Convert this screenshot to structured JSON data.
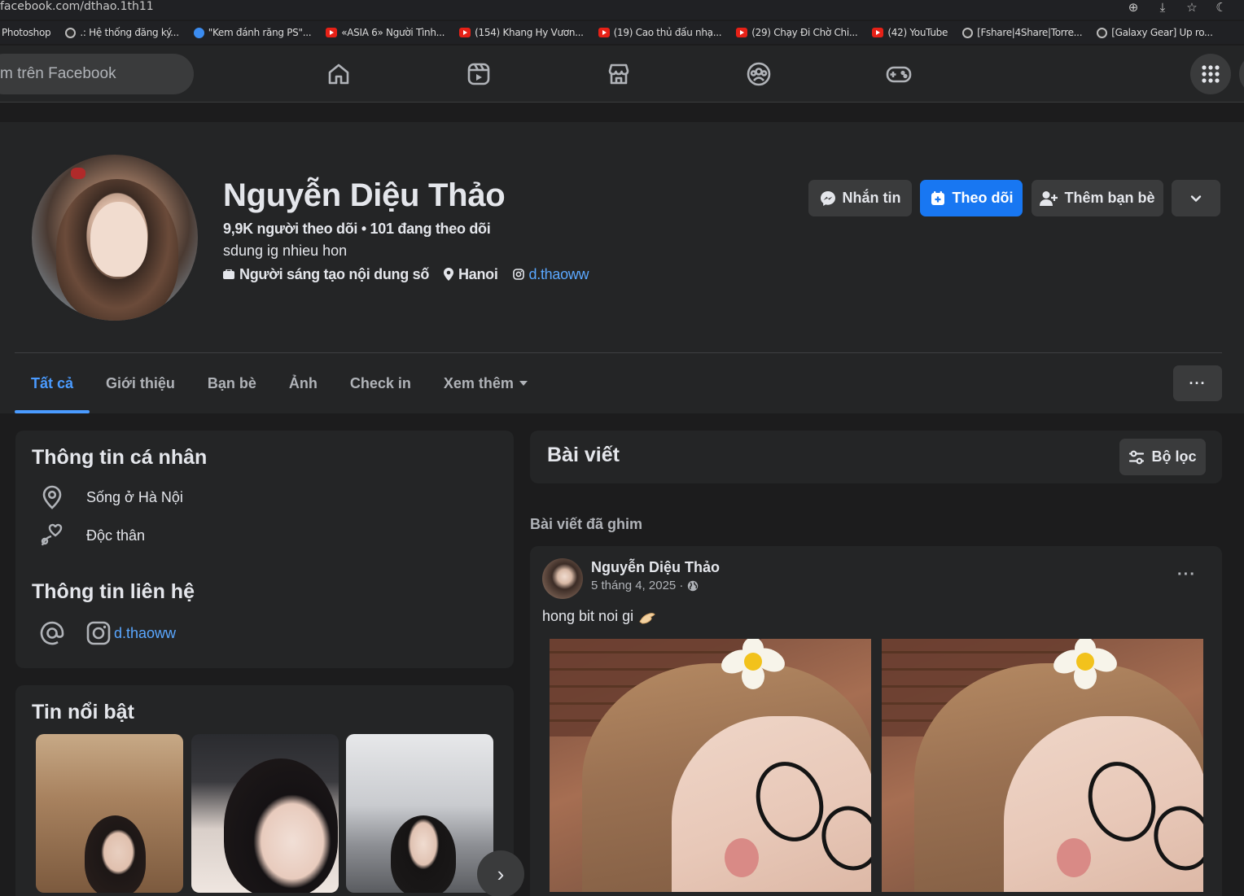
{
  "browser": {
    "url": "facebook.com/dthao.1th11",
    "bookmarks": [
      {
        "label": "Photoshop",
        "icon": "none"
      },
      {
        "label": ".: Hệ thống đăng ký...",
        "icon": "globe"
      },
      {
        "label": "\"Kem đánh răng PS\"...",
        "icon": "blue"
      },
      {
        "label": "«ASIA 6» Người Tình...",
        "icon": "youtube"
      },
      {
        "label": "(154) Khang Hy Vươn...",
        "icon": "youtube"
      },
      {
        "label": "(19) Cao thủ đấu nhạ...",
        "icon": "youtube"
      },
      {
        "label": "(29) Chạy Đi Chờ Chi...",
        "icon": "youtube"
      },
      {
        "label": "(42) YouTube",
        "icon": "youtube"
      },
      {
        "label": "[Fshare|4Share|Torre...",
        "icon": "globe"
      },
      {
        "label": "[Galaxy Gear] Up ro...",
        "icon": "globe"
      }
    ]
  },
  "nav": {
    "search_placeholder": "m trên Facebook",
    "icons": [
      "home-icon",
      "reels-icon",
      "marketplace-icon",
      "groups-icon",
      "gaming-icon"
    ],
    "menu_icon": "grid-menu-icon"
  },
  "profile": {
    "name": "Nguyễn Diệu Thảo",
    "stats": "9,9K người theo dõi • 101 đang theo dõi",
    "bio": "sdung ig nhieu hon",
    "category": "Người sáng tạo nội dung số",
    "location": "Hanoi",
    "instagram": "d.thaoww",
    "buttons": {
      "message": "Nhắn tin",
      "follow": "Theo dõi",
      "add_friend": "Thêm bạn bè"
    }
  },
  "tabs": {
    "items": [
      "Tất cả",
      "Giới thiệu",
      "Bạn bè",
      "Ảnh",
      "Check in",
      "Xem thêm"
    ],
    "active": "Tất cả",
    "more_label": "···"
  },
  "intro": {
    "title": "Thông tin cá nhân",
    "lives_in": "Sống ở Hà Nội",
    "relationship": "Độc thân",
    "contact_title": "Thông tin liên hệ",
    "instagram": "d.thaoww"
  },
  "featured": {
    "title": "Tin nổi bật",
    "next_label": "›"
  },
  "posts": {
    "title": "Bài viết",
    "filter_label": "Bộ lọc",
    "pinned_label": "Bài viết đã ghim",
    "pinned_post": {
      "author": "Nguyễn Diệu Thảo",
      "date": "5 tháng 4, 2025 ·",
      "text": "hong bit noi gi",
      "menu_label": "···"
    }
  },
  "colors": {
    "background": "#1c1c1d",
    "surface": "#242526",
    "button": "#3a3b3c",
    "accent": "#1877f2",
    "link": "#5aa7ff"
  }
}
